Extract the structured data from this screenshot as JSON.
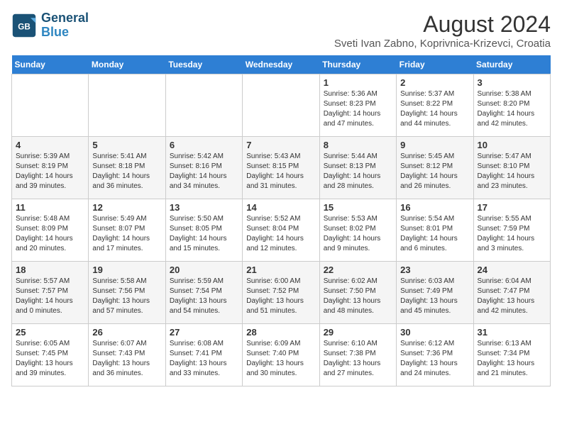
{
  "header": {
    "logo_line1": "General",
    "logo_line2": "Blue",
    "month_year": "August 2024",
    "location": "Sveti Ivan Zabno, Koprivnica-Krizevci, Croatia"
  },
  "days_of_week": [
    "Sunday",
    "Monday",
    "Tuesday",
    "Wednesday",
    "Thursday",
    "Friday",
    "Saturday"
  ],
  "weeks": [
    [
      {
        "day": "",
        "info": ""
      },
      {
        "day": "",
        "info": ""
      },
      {
        "day": "",
        "info": ""
      },
      {
        "day": "",
        "info": ""
      },
      {
        "day": "1",
        "info": "Sunrise: 5:36 AM\nSunset: 8:23 PM\nDaylight: 14 hours and 47 minutes."
      },
      {
        "day": "2",
        "info": "Sunrise: 5:37 AM\nSunset: 8:22 PM\nDaylight: 14 hours and 44 minutes."
      },
      {
        "day": "3",
        "info": "Sunrise: 5:38 AM\nSunset: 8:20 PM\nDaylight: 14 hours and 42 minutes."
      }
    ],
    [
      {
        "day": "4",
        "info": "Sunrise: 5:39 AM\nSunset: 8:19 PM\nDaylight: 14 hours and 39 minutes."
      },
      {
        "day": "5",
        "info": "Sunrise: 5:41 AM\nSunset: 8:18 PM\nDaylight: 14 hours and 36 minutes."
      },
      {
        "day": "6",
        "info": "Sunrise: 5:42 AM\nSunset: 8:16 PM\nDaylight: 14 hours and 34 minutes."
      },
      {
        "day": "7",
        "info": "Sunrise: 5:43 AM\nSunset: 8:15 PM\nDaylight: 14 hours and 31 minutes."
      },
      {
        "day": "8",
        "info": "Sunrise: 5:44 AM\nSunset: 8:13 PM\nDaylight: 14 hours and 28 minutes."
      },
      {
        "day": "9",
        "info": "Sunrise: 5:45 AM\nSunset: 8:12 PM\nDaylight: 14 hours and 26 minutes."
      },
      {
        "day": "10",
        "info": "Sunrise: 5:47 AM\nSunset: 8:10 PM\nDaylight: 14 hours and 23 minutes."
      }
    ],
    [
      {
        "day": "11",
        "info": "Sunrise: 5:48 AM\nSunset: 8:09 PM\nDaylight: 14 hours and 20 minutes."
      },
      {
        "day": "12",
        "info": "Sunrise: 5:49 AM\nSunset: 8:07 PM\nDaylight: 14 hours and 17 minutes."
      },
      {
        "day": "13",
        "info": "Sunrise: 5:50 AM\nSunset: 8:05 PM\nDaylight: 14 hours and 15 minutes."
      },
      {
        "day": "14",
        "info": "Sunrise: 5:52 AM\nSunset: 8:04 PM\nDaylight: 14 hours and 12 minutes."
      },
      {
        "day": "15",
        "info": "Sunrise: 5:53 AM\nSunset: 8:02 PM\nDaylight: 14 hours and 9 minutes."
      },
      {
        "day": "16",
        "info": "Sunrise: 5:54 AM\nSunset: 8:01 PM\nDaylight: 14 hours and 6 minutes."
      },
      {
        "day": "17",
        "info": "Sunrise: 5:55 AM\nSunset: 7:59 PM\nDaylight: 14 hours and 3 minutes."
      }
    ],
    [
      {
        "day": "18",
        "info": "Sunrise: 5:57 AM\nSunset: 7:57 PM\nDaylight: 14 hours and 0 minutes."
      },
      {
        "day": "19",
        "info": "Sunrise: 5:58 AM\nSunset: 7:56 PM\nDaylight: 13 hours and 57 minutes."
      },
      {
        "day": "20",
        "info": "Sunrise: 5:59 AM\nSunset: 7:54 PM\nDaylight: 13 hours and 54 minutes."
      },
      {
        "day": "21",
        "info": "Sunrise: 6:00 AM\nSunset: 7:52 PM\nDaylight: 13 hours and 51 minutes."
      },
      {
        "day": "22",
        "info": "Sunrise: 6:02 AM\nSunset: 7:50 PM\nDaylight: 13 hours and 48 minutes."
      },
      {
        "day": "23",
        "info": "Sunrise: 6:03 AM\nSunset: 7:49 PM\nDaylight: 13 hours and 45 minutes."
      },
      {
        "day": "24",
        "info": "Sunrise: 6:04 AM\nSunset: 7:47 PM\nDaylight: 13 hours and 42 minutes."
      }
    ],
    [
      {
        "day": "25",
        "info": "Sunrise: 6:05 AM\nSunset: 7:45 PM\nDaylight: 13 hours and 39 minutes."
      },
      {
        "day": "26",
        "info": "Sunrise: 6:07 AM\nSunset: 7:43 PM\nDaylight: 13 hours and 36 minutes."
      },
      {
        "day": "27",
        "info": "Sunrise: 6:08 AM\nSunset: 7:41 PM\nDaylight: 13 hours and 33 minutes."
      },
      {
        "day": "28",
        "info": "Sunrise: 6:09 AM\nSunset: 7:40 PM\nDaylight: 13 hours and 30 minutes."
      },
      {
        "day": "29",
        "info": "Sunrise: 6:10 AM\nSunset: 7:38 PM\nDaylight: 13 hours and 27 minutes."
      },
      {
        "day": "30",
        "info": "Sunrise: 6:12 AM\nSunset: 7:36 PM\nDaylight: 13 hours and 24 minutes."
      },
      {
        "day": "31",
        "info": "Sunrise: 6:13 AM\nSunset: 7:34 PM\nDaylight: 13 hours and 21 minutes."
      }
    ]
  ]
}
